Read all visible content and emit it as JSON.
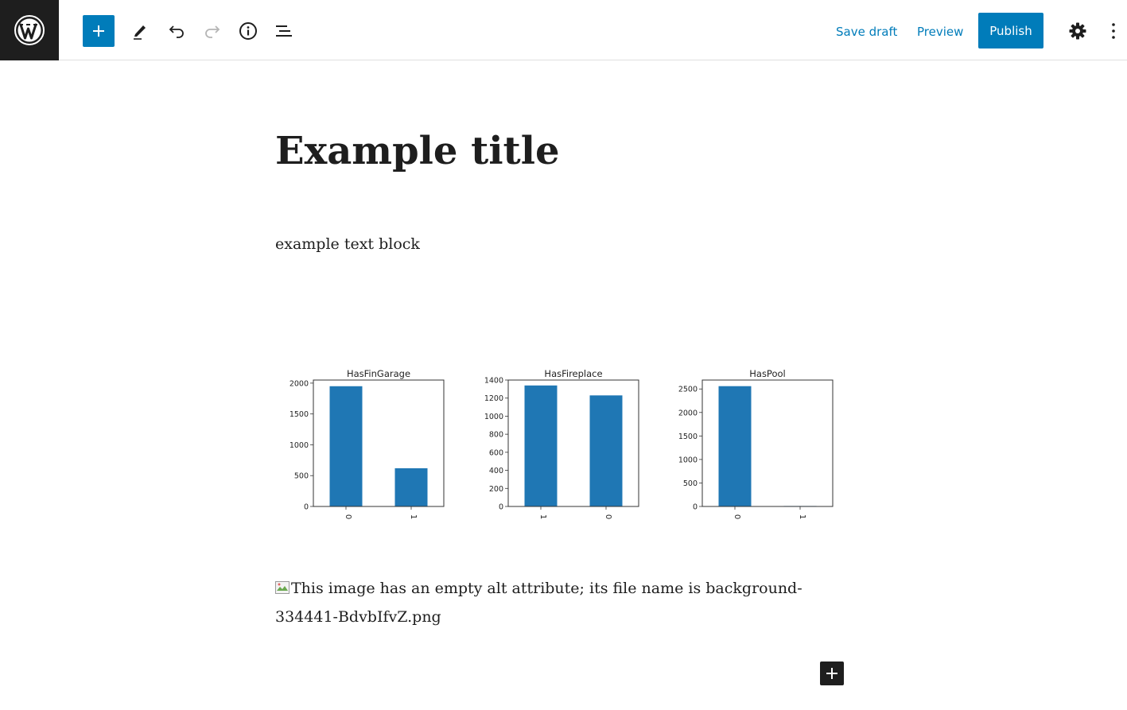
{
  "toolbar": {
    "save_draft_label": "Save draft",
    "preview_label": "Preview",
    "publish_label": "Publish"
  },
  "icons": [
    "wordpress-logo-icon",
    "plus-icon",
    "pencil-icon",
    "undo-icon",
    "redo-icon",
    "info-icon",
    "list-view-icon",
    "gear-icon",
    "more-vertical-icon",
    "broken-image-icon"
  ],
  "colors": {
    "accent": "#007cba",
    "dark": "#1e1e1e",
    "bar": "#1f77b4"
  },
  "post": {
    "title": "Example title",
    "paragraph": "example text block",
    "broken_image_alt": "This image has an empty alt attribute; its file name is background-334441-BdvbIfvZ.png"
  },
  "chart_data": [
    {
      "type": "bar",
      "title": "HasFinGarage",
      "categories": [
        "0",
        "1"
      ],
      "values": [
        1950,
        620
      ],
      "ylim": [
        0,
        2050
      ],
      "yticks": [
        0,
        500,
        1000,
        1500,
        2000
      ]
    },
    {
      "type": "bar",
      "title": "HasFireplace",
      "categories": [
        "1",
        "0"
      ],
      "values": [
        1340,
        1230
      ],
      "ylim": [
        0,
        1400
      ],
      "yticks": [
        0,
        200,
        400,
        600,
        800,
        1000,
        1200,
        1400
      ]
    },
    {
      "type": "bar",
      "title": "HasPool",
      "categories": [
        "0",
        "1"
      ],
      "values": [
        2560,
        10
      ],
      "ylim": [
        0,
        2690
      ],
      "yticks": [
        0,
        500,
        1000,
        1500,
        2000,
        2500
      ]
    }
  ]
}
